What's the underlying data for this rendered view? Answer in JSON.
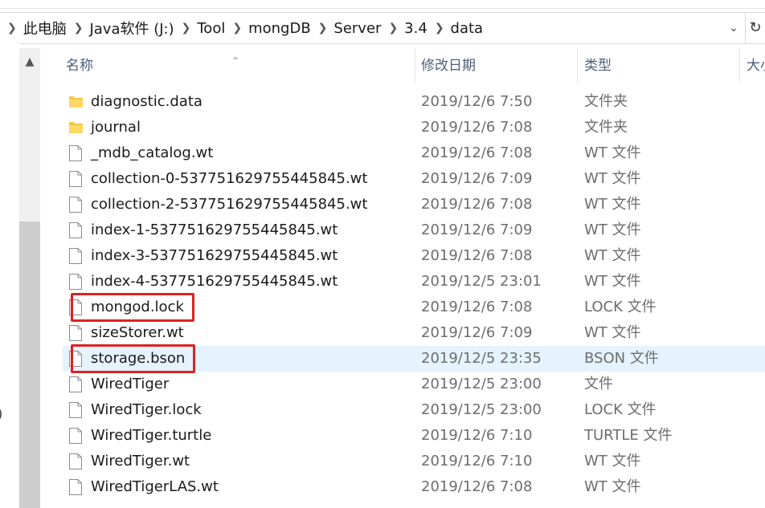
{
  "breadcrumb": {
    "segments": [
      "此电脑",
      "Java软件 (J:)",
      "Tool",
      "mongDB",
      "Server",
      "3.4",
      "data"
    ]
  },
  "columns": {
    "name": "名称",
    "modified": "修改日期",
    "type": "类型",
    "size": "大小"
  },
  "files": [
    {
      "name": "diagnostic.data",
      "modified": "2019/12/6 7:50",
      "type": "文件夹",
      "icon": "folder-icon"
    },
    {
      "name": "journal",
      "modified": "2019/12/6 7:08",
      "type": "文件夹",
      "icon": "folder-icon"
    },
    {
      "name": "_mdb_catalog.wt",
      "modified": "2019/12/6 7:08",
      "type": "WT 文件",
      "icon": "file-icon"
    },
    {
      "name": "collection-0-537751629755445845.wt",
      "modified": "2019/12/6 7:09",
      "type": "WT 文件",
      "icon": "file-icon"
    },
    {
      "name": "collection-2-537751629755445845.wt",
      "modified": "2019/12/6 7:08",
      "type": "WT 文件",
      "icon": "file-icon"
    },
    {
      "name": "index-1-537751629755445845.wt",
      "modified": "2019/12/6 7:09",
      "type": "WT 文件",
      "icon": "file-icon"
    },
    {
      "name": "index-3-537751629755445845.wt",
      "modified": "2019/12/6 7:08",
      "type": "WT 文件",
      "icon": "file-icon"
    },
    {
      "name": "index-4-537751629755445845.wt",
      "modified": "2019/12/5 23:01",
      "type": "WT 文件",
      "icon": "file-icon"
    },
    {
      "name": "mongod.lock",
      "modified": "2019/12/6 7:08",
      "type": "LOCK 文件",
      "icon": "file-icon"
    },
    {
      "name": "sizeStorer.wt",
      "modified": "2019/12/6 7:09",
      "type": "WT 文件",
      "icon": "file-icon"
    },
    {
      "name": "storage.bson",
      "modified": "2019/12/5 23:35",
      "type": "BSON 文件",
      "icon": "file-icon"
    },
    {
      "name": "WiredTiger",
      "modified": "2019/12/5 23:00",
      "type": "文件",
      "icon": "file-icon"
    },
    {
      "name": "WiredTiger.lock",
      "modified": "2019/12/5 23:00",
      "type": "LOCK 文件",
      "icon": "file-icon"
    },
    {
      "name": "WiredTiger.turtle",
      "modified": "2019/12/6 7:10",
      "type": "TURTLE 文件",
      "icon": "file-icon"
    },
    {
      "name": "WiredTiger.wt",
      "modified": "2019/12/6 7:10",
      "type": "WT 文件",
      "icon": "file-icon"
    },
    {
      "name": "WiredTigerLAS.wt",
      "modified": "2019/12/6 7:08",
      "type": "WT 文件",
      "icon": "file-icon"
    }
  ],
  "selected_file": "storage.bson",
  "highlighted_files": [
    "mongod.lock",
    "storage.bson"
  ],
  "left_pane_glyph": ")",
  "colors": {
    "selection": "#e5f3ff",
    "highlight_box": "#e02020",
    "header_text": "#4c607a",
    "meta_text": "#6d6d6d"
  }
}
